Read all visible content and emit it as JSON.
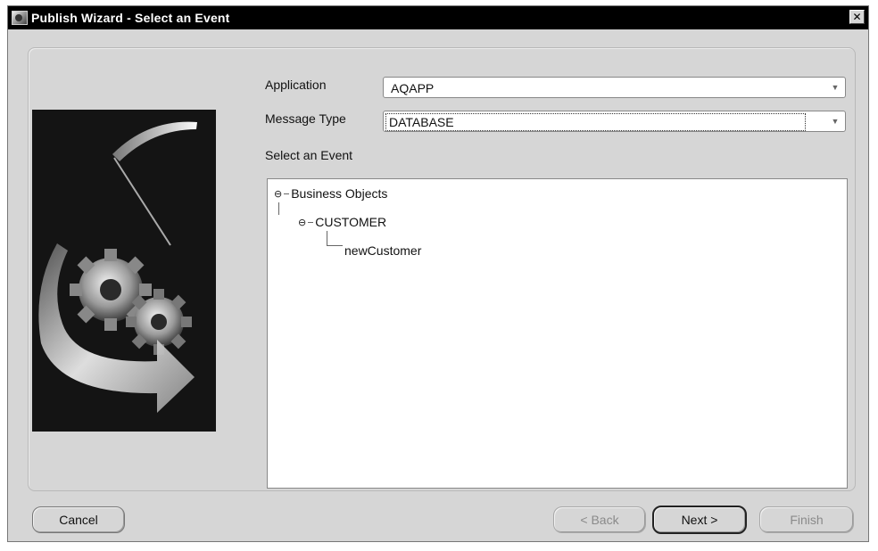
{
  "window": {
    "title": "Publish Wizard - Select an Event",
    "close_glyph": "✕"
  },
  "form": {
    "application_label": "Application",
    "application_value": "AQAPP",
    "message_type_label": "Message Type",
    "message_type_value": "DATABASE",
    "select_event_label": "Select an Event",
    "dropdown_icon": "chevron-down-icon"
  },
  "tree": {
    "root": {
      "label": "Business Objects",
      "expanded": true
    },
    "child": {
      "label": "CUSTOMER",
      "expanded": true
    },
    "leaf": {
      "label": "newCustomer"
    },
    "collapse_glyph": "⊖"
  },
  "buttons": {
    "cancel": "Cancel",
    "back": "< Back",
    "next": "Next >",
    "finish": "Finish"
  },
  "colors": {
    "titlebar_bg": "#000000",
    "window_bg": "#d6d6d6",
    "disabled_text": "#8a8a8a"
  }
}
